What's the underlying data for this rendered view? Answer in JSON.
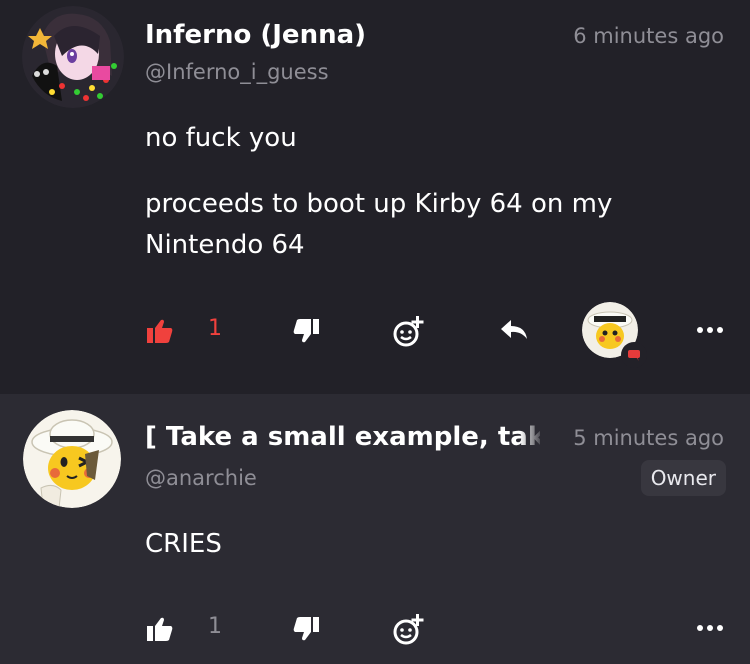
{
  "comments": [
    {
      "author": "Inferno (Jenna)",
      "handle": "@Inferno_i_guess",
      "time": "6 minutes ago",
      "lines": [
        "no fuck you",
        "proceeds to boot up Kirby 64 on my Nintendo 64"
      ],
      "likes": "1",
      "liked": true
    },
    {
      "author": "[ Take a small example, take",
      "handle": "@anarchie",
      "time": "5 minutes ago",
      "role_badge": "Owner",
      "lines": [
        "CRIES"
      ],
      "likes": "1",
      "liked": false
    }
  ],
  "colors": {
    "like_active": "#f0413d",
    "muted": "#8f8e96",
    "bg_primary": "#222128",
    "bg_secondary": "#2c2b33"
  },
  "icons": [
    "thumbs-up-icon",
    "thumbs-down-icon",
    "add-reaction-icon",
    "reply-icon",
    "more-icon"
  ]
}
